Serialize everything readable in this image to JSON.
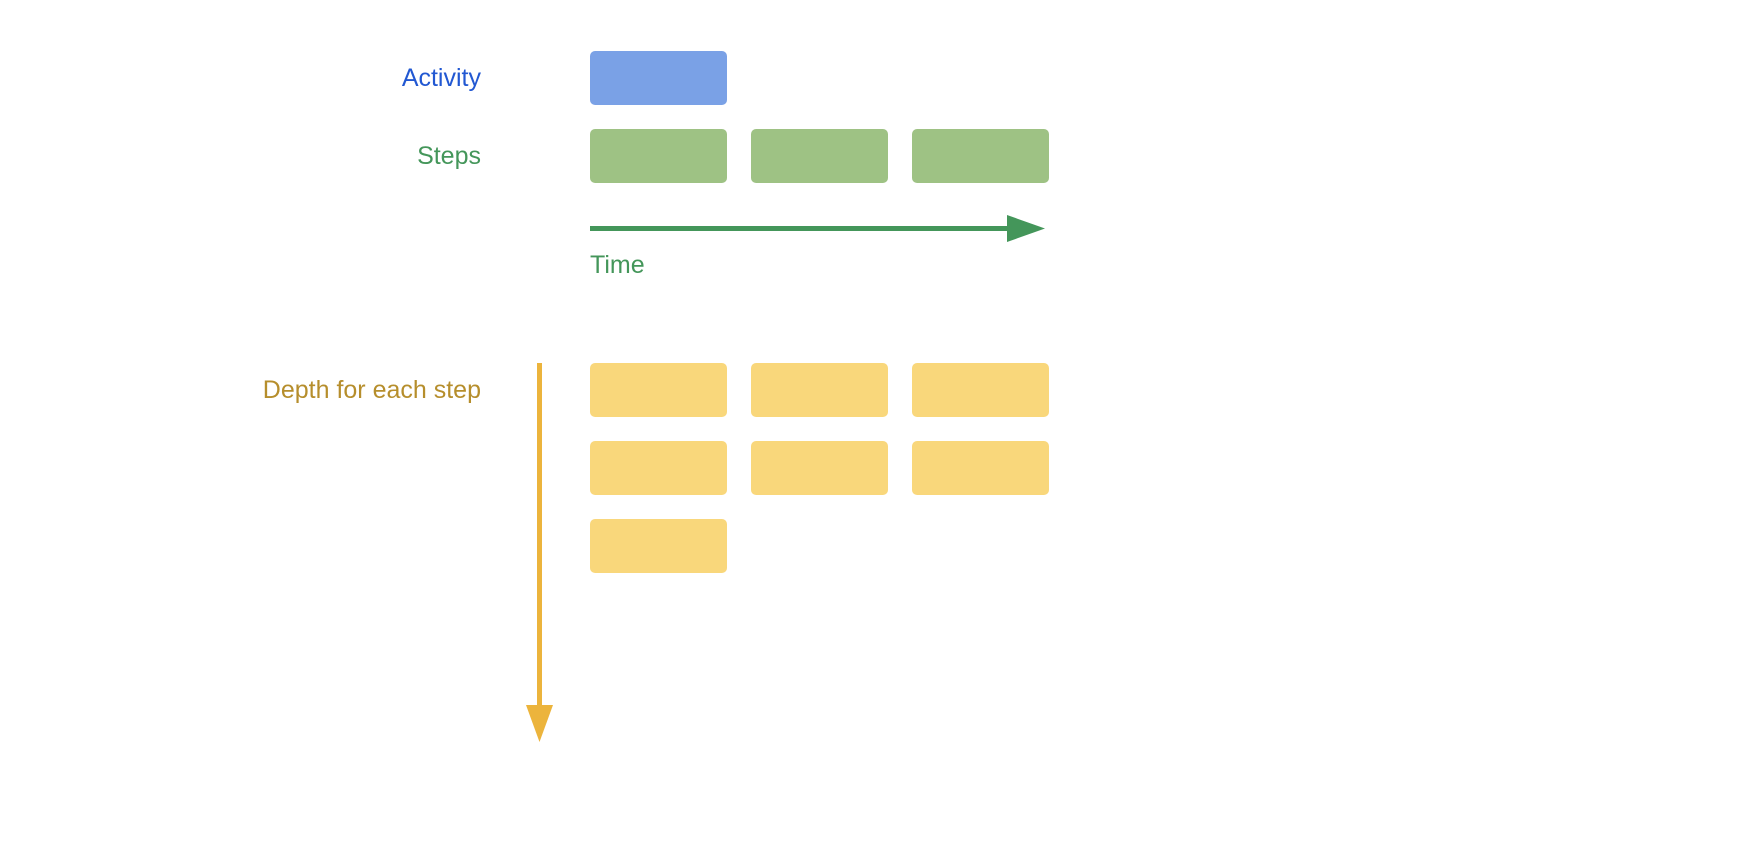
{
  "labels": {
    "activity": "Activity",
    "steps": "Steps",
    "time": "Time",
    "depth": "Depth for each step"
  },
  "colors": {
    "activity_text": "#2258d2",
    "activity_box": "#7aa1e6",
    "steps_text": "#44965a",
    "steps_box": "#9ec284",
    "time_arrow": "#44965a",
    "depth_text": "#b68e2c",
    "depth_box": "#f9d77b",
    "depth_arrow": "#ecb43c"
  },
  "structure": {
    "activity_count": 1,
    "step_count": 3,
    "depth_rows": [
      3,
      3,
      1
    ]
  }
}
